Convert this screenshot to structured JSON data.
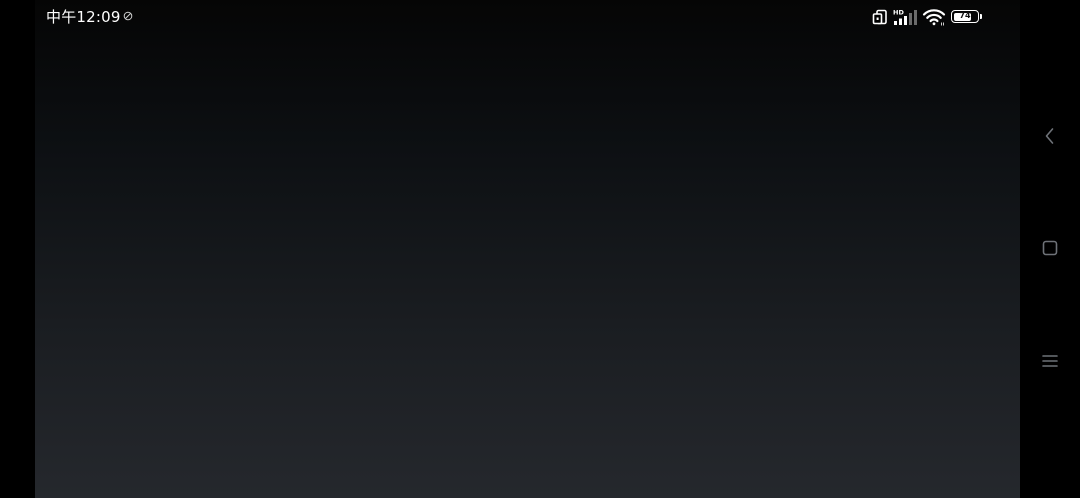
{
  "status_bar": {
    "time": "中午12:09",
    "icons": [
      "do-not-disturb-icon",
      "screen-rotate-icon",
      "cellular-signal-icon",
      "wifi-icon",
      "battery-icon"
    ],
    "network_label": "HD",
    "battery_level": "74"
  },
  "navigation_bar": {
    "buttons": [
      "back-icon",
      "home-icon",
      "menu-icon"
    ]
  },
  "colors": {
    "background": "#000000",
    "content_top": "#050505",
    "content_bottom": "#25282d",
    "icon": "#ffffff",
    "nav_icon": "#6e7278"
  }
}
